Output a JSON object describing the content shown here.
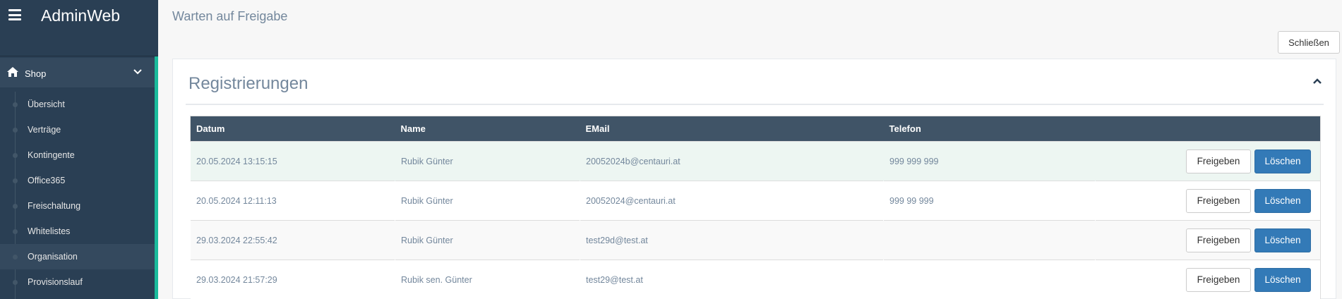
{
  "app": {
    "brand": "AdminWeb"
  },
  "sidebar": {
    "section": {
      "label": "Shop",
      "icon": "home-icon"
    },
    "items": [
      {
        "label": "Übersicht"
      },
      {
        "label": "Verträge"
      },
      {
        "label": "Kontingente"
      },
      {
        "label": "Office365"
      },
      {
        "label": "Freischaltung"
      },
      {
        "label": "Whitelistes"
      },
      {
        "label": "Organisation",
        "active": true
      },
      {
        "label": "Provisionslauf"
      }
    ]
  },
  "header": {
    "title": "Warten auf Freigabe",
    "close_label": "Schließen"
  },
  "panel": {
    "title": "Registrierungen",
    "columns": [
      "Datum",
      "Name",
      "EMail",
      "Telefon",
      ""
    ],
    "rows": [
      {
        "datum": "20.05.2024 13:15:15",
        "name": "Rubik Günter",
        "email": "20052024b@centauri.at",
        "telefon": "999 999 999"
      },
      {
        "datum": "20.05.2024 12:11:13",
        "name": "Rubik Günter",
        "email": "20052024@centauri.at",
        "telefon": "999 99 999"
      },
      {
        "datum": "29.03.2024 22:55:42",
        "name": "Rubik Günter",
        "email": "test29d@test.at",
        "telefon": ""
      },
      {
        "datum": "29.03.2024 21:57:29",
        "name": "Rubik sen. Günter",
        "email": "test29@test.at",
        "telefon": ""
      }
    ],
    "approve_label": "Freigeben",
    "delete_label": "Löschen"
  },
  "colors": {
    "sidebar": "#2a3f54",
    "accent": "#1abb9c",
    "primary": "#337ab7",
    "table_header": "#405467"
  }
}
